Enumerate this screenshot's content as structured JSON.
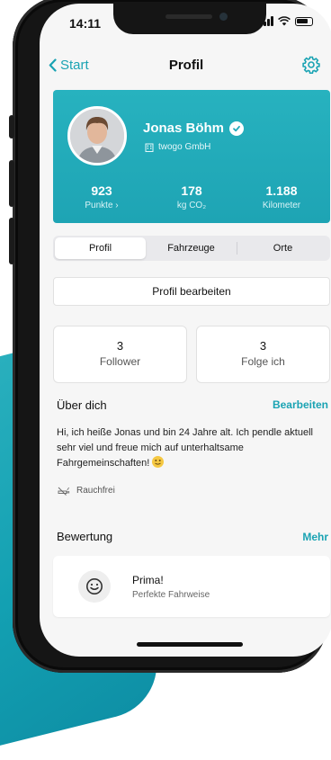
{
  "status": {
    "time": "14:11"
  },
  "nav": {
    "back_label": "Start",
    "title": "Profil",
    "settings_icon": "gear-icon"
  },
  "profile": {
    "name": "Jonas Böhm",
    "company": "twogo GmbH",
    "stats": [
      {
        "value": "923",
        "label": "Punkte  ›"
      },
      {
        "value": "178",
        "label": "kg CO₂"
      },
      {
        "value": "1.188",
        "label": "Kilometer"
      }
    ]
  },
  "tabs": [
    {
      "label": "Profil",
      "active": true
    },
    {
      "label": "Fahrzeuge",
      "active": false
    },
    {
      "label": "Orte",
      "active": false
    }
  ],
  "edit_profile_label": "Profil bearbeiten",
  "follow": {
    "followers": {
      "count": "3",
      "label": "Follower"
    },
    "following": {
      "count": "3",
      "label": "Folge ich"
    }
  },
  "about": {
    "title": "Über dich",
    "edit_label": "Bearbeiten",
    "text": "Hi, ich heiße Jonas und bin 24 Jahre alt. Ich pendle aktuell sehr viel und freue mich auf unterhaltsame Fahrgemeinschaften!",
    "tag": "Rauchfrei"
  },
  "rating": {
    "title": "Bewertung",
    "more_label": "Mehr",
    "item_title": "Prima!",
    "item_subtitle": "Perfekte Fahrweise"
  },
  "colors": {
    "accent": "#1aa3b3",
    "card": "#22aabb"
  }
}
